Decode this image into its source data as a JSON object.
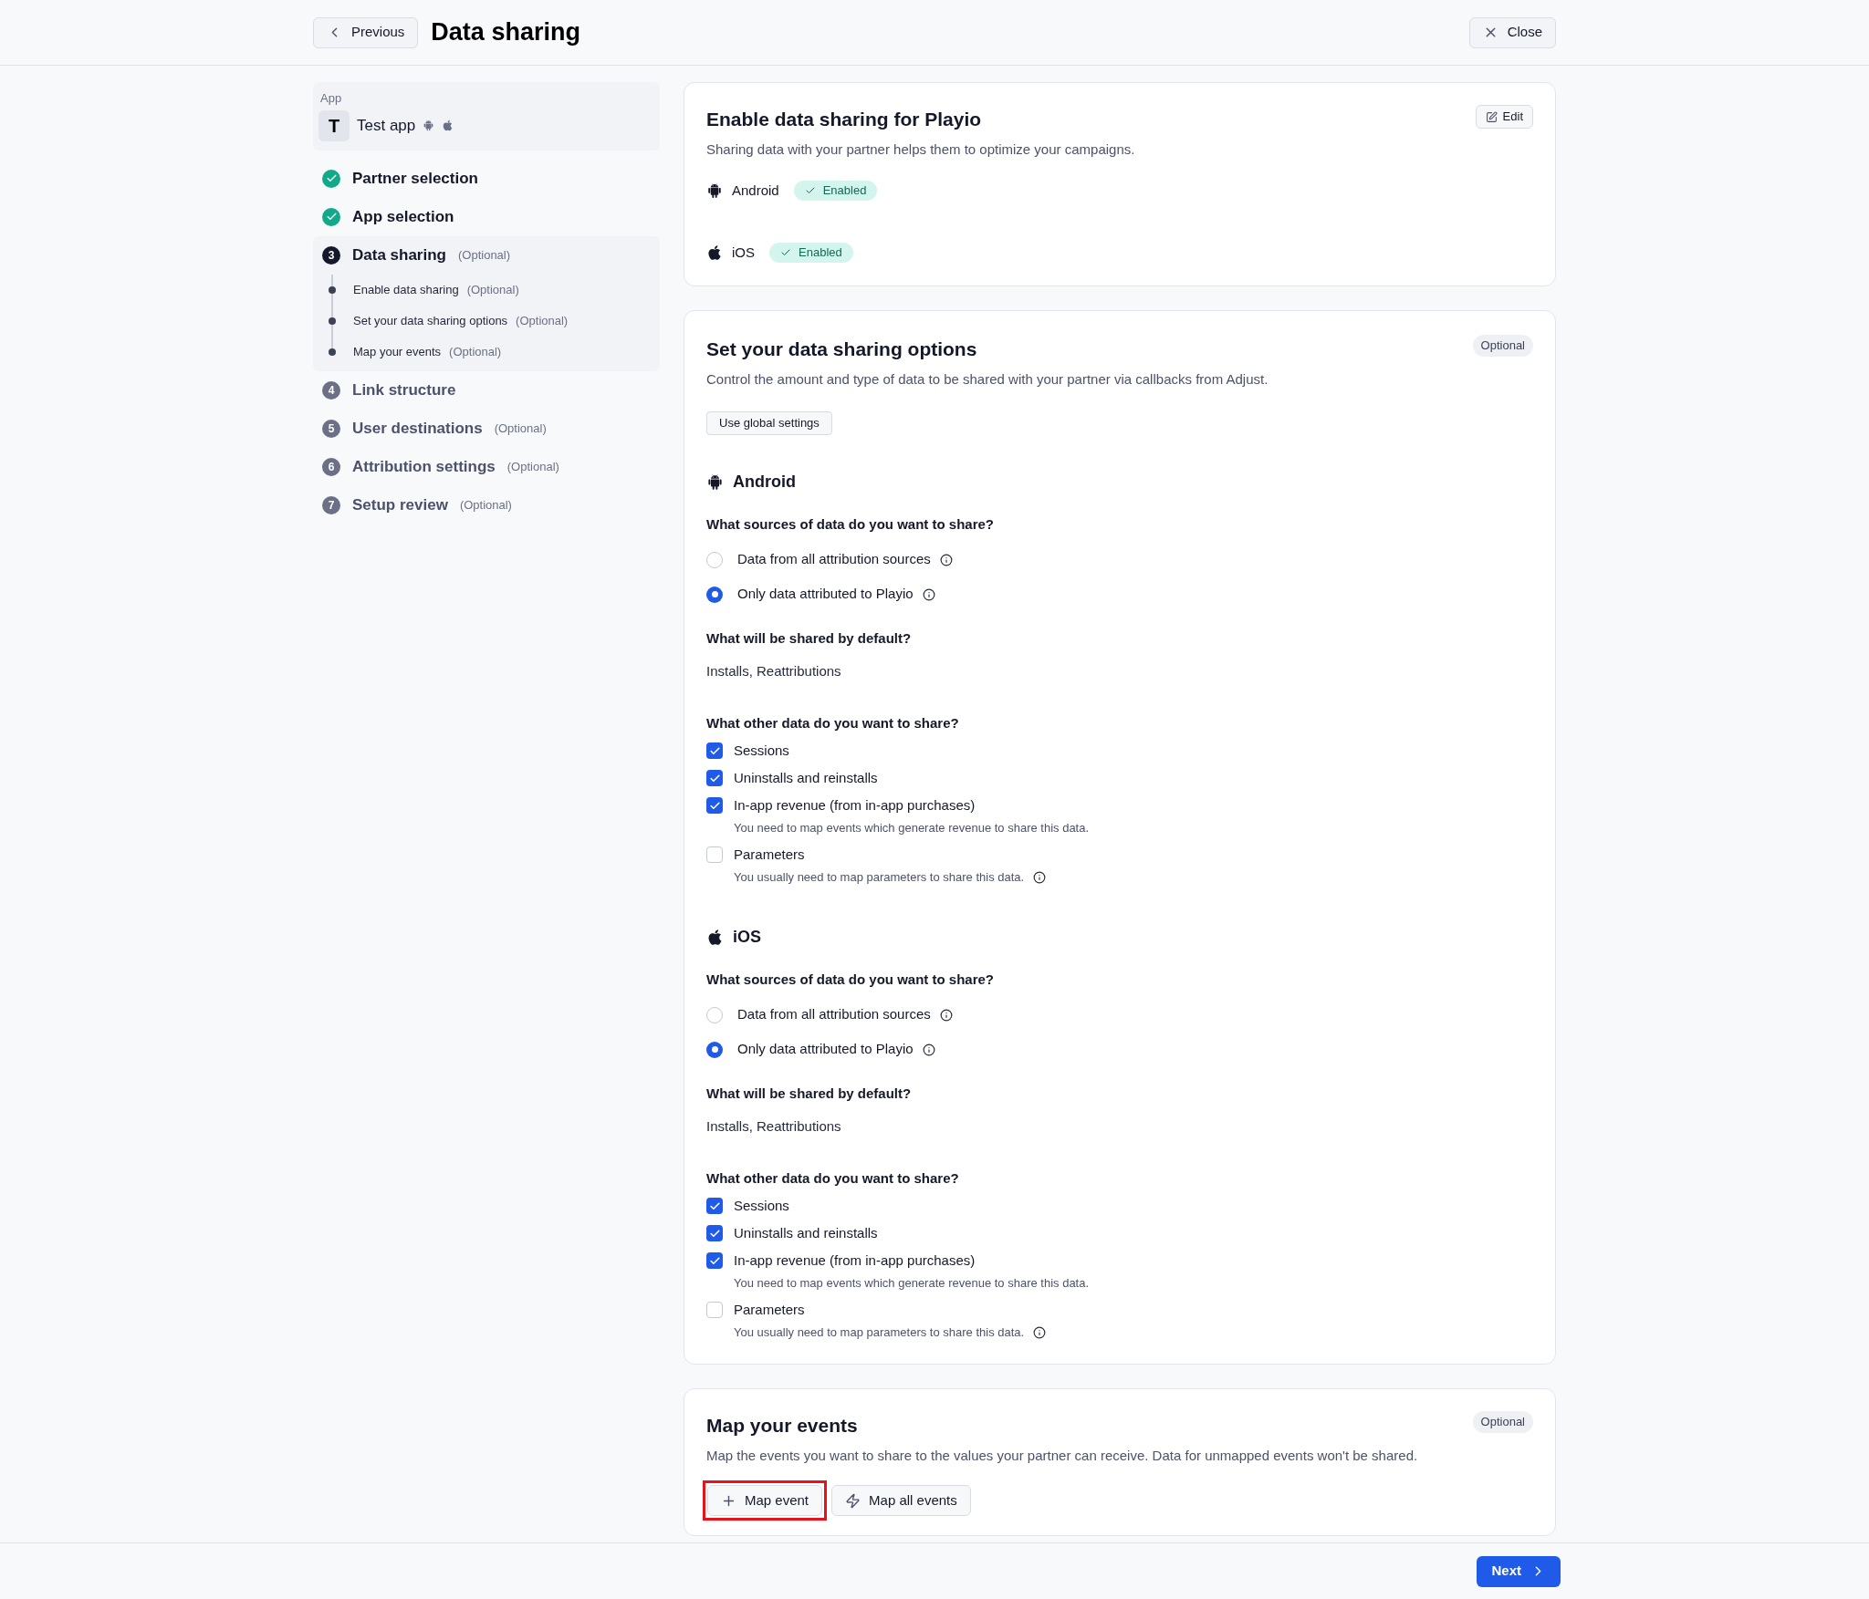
{
  "header": {
    "back_label": "Previous",
    "title": "Data sharing",
    "close_label": "Close"
  },
  "sidebar": {
    "app_label": "App",
    "app_initial": "T",
    "app_name": "Test app",
    "steps": [
      {
        "title": "Partner selection",
        "done": true,
        "selected": false
      },
      {
        "title": "App selection",
        "done": true,
        "selected": false
      },
      {
        "number": "3",
        "title": "Data sharing",
        "optional": "(Optional)",
        "done": false,
        "selected": true,
        "children": [
          {
            "title": "Enable data sharing",
            "optional": "(Optional)"
          },
          {
            "title": "Set your data sharing options",
            "optional": "(Optional)"
          },
          {
            "title": "Map your events",
            "optional": "(Optional)"
          }
        ]
      },
      {
        "number": "4",
        "title": "Link structure",
        "done": false,
        "selected": false
      },
      {
        "number": "5",
        "title": "User destinations",
        "optional": "(Optional)",
        "done": false,
        "selected": false
      },
      {
        "number": "6",
        "title": "Attribution settings",
        "optional": "(Optional)",
        "done": false,
        "selected": false
      },
      {
        "number": "7",
        "title": "Setup review",
        "optional": "(Optional)",
        "done": false,
        "selected": false
      }
    ]
  },
  "enable_card": {
    "title": "Enable data sharing for Playio",
    "description": "Sharing data with your partner helps them to optimize your campaigns.",
    "edit_label": "Edit",
    "platforms": [
      {
        "kind": "android",
        "name": "Android",
        "status": "Enabled"
      },
      {
        "kind": "ios",
        "name": "iOS",
        "status": "Enabled"
      }
    ]
  },
  "options_card": {
    "title": "Set your data sharing options",
    "badge": "Optional",
    "description": "Control the amount and type of data to be shared with your partner via callbacks from Adjust.",
    "global_button": "Use global settings",
    "platforms": [
      {
        "kind": "android",
        "name": "Android",
        "sources_question": "What sources of data do you want to share?",
        "sources": [
          {
            "label": "Data from all attribution sources",
            "selected": false
          },
          {
            "label": "Only data attributed to Playio",
            "selected": true
          }
        ],
        "default_question": "What will be shared by default?",
        "default_value": "Installs, Reattributions",
        "other_question": "What other data do you want to share?",
        "options": [
          {
            "label": "Sessions",
            "checked": true
          },
          {
            "label": "Uninstalls and reinstalls",
            "checked": true
          },
          {
            "label": "In-app revenue (from in-app purchases)",
            "checked": true,
            "note": "You need to map events which generate revenue to share this data.",
            "note_info": false
          },
          {
            "label": "Parameters",
            "checked": false,
            "note": "You usually need to map parameters to share this data.",
            "note_info": true
          }
        ]
      },
      {
        "kind": "ios",
        "name": "iOS",
        "sources_question": "What sources of data do you want to share?",
        "sources": [
          {
            "label": "Data from all attribution sources",
            "selected": false
          },
          {
            "label": "Only data attributed to Playio",
            "selected": true
          }
        ],
        "default_question": "What will be shared by default?",
        "default_value": "Installs, Reattributions",
        "other_question": "What other data do you want to share?",
        "options": [
          {
            "label": "Sessions",
            "checked": true
          },
          {
            "label": "Uninstalls and reinstalls",
            "checked": true
          },
          {
            "label": "In-app revenue (from in-app purchases)",
            "checked": true,
            "note": "You need to map events which generate revenue to share this data.",
            "note_info": false
          },
          {
            "label": "Parameters",
            "checked": false,
            "note": "You usually need to map parameters to share this data.",
            "note_info": true
          }
        ]
      }
    ]
  },
  "events_card": {
    "title": "Map your events",
    "badge": "Optional",
    "description": "Map the events you want to share to the values your partner can receive. Data for unmapped events won't be shared.",
    "buttons": [
      {
        "kind": "add",
        "label": "Map event",
        "highlighted": true
      },
      {
        "kind": "bolt",
        "label": "Map all events",
        "highlighted": false
      }
    ]
  },
  "footer": {
    "next_label": "Next"
  }
}
